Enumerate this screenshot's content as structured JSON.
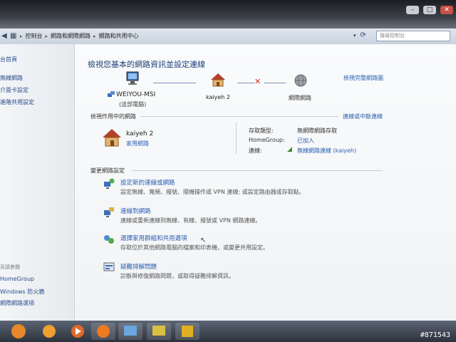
{
  "address_bar": {
    "crumbs": [
      "控制台",
      "網路和網際網路",
      "網路和共用中心"
    ],
    "search_placeholder": "搜尋控制台"
  },
  "sidebar": {
    "items": [
      "台首頁",
      "無線網路",
      "介面卡設定",
      "進階共用設定"
    ],
    "see_also_label": "另請參閱",
    "see_also": [
      "HomeGroup",
      "Windows 防火牆",
      "網際網路選項"
    ]
  },
  "main": {
    "title": "檢視您基本的網路資訊並設定連線",
    "view_full_map": "檢視完整網路圖",
    "map": {
      "computer_name": "WEIYOU-MSI",
      "computer_sub": "(這部電腦)",
      "network_name": "kaiyeh 2",
      "internet_label": "網際網路"
    },
    "active_header": "檢視作用中的網路",
    "connect_disconnect": "連線或中斷連線",
    "active": {
      "name": "kaiyeh 2",
      "type": "家用網路",
      "access_type_label": "存取類型:",
      "access_type_value": "無網際網路存取",
      "homegroup_label": "HomeGroup:",
      "homegroup_value": "已加入",
      "connections_label": "連線:",
      "connections_value": "無線網路連線 (kaiyeh)"
    },
    "change_header": "變更網路設定",
    "tasks": [
      {
        "title": "設定新的連線或網路",
        "desc": "設定無線、寬頻、撥號、隨機操作或 VPN 連線; 或設定路由器或存取點。"
      },
      {
        "title": "連線到網路",
        "desc": "連線或重新連線到無線、有線、撥號或 VPN 網路連線。"
      },
      {
        "title": "選擇家用群組和共用選項",
        "desc": "存取位於其他網路電腦的檔案和印表機，或變更共用設定。"
      },
      {
        "title": "疑難排解問題",
        "desc": "診斷與修復網路問題，或取得疑難排解資訊。"
      }
    ]
  },
  "watermark": "#871543"
}
